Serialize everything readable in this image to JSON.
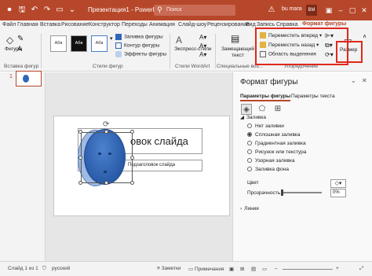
{
  "titlebar": {
    "title": "Презентация1 - PowerPoint",
    "search_placeholder": "Поиск",
    "user": "bu mara",
    "avatar": "BM",
    "bg_color": "#b7472a"
  },
  "tabs": [
    "Файл",
    "Главная",
    "Вставка",
    "Рисование",
    "Конструктор",
    "Переходы",
    "Анимация",
    "Слайд-шоу",
    "Рецензирование",
    "Вид",
    "Запись",
    "Справка",
    "Формат фигуры"
  ],
  "active_tab": "Формат фигуры",
  "ribbon": {
    "insert_shapes_label": "Фигуры",
    "insert_shapes_group": "Вставка фигур",
    "style_box_label": "Абв",
    "fill_label": "Заливка фигуры",
    "outline_label": "Контур фигуры",
    "effects_label": "Эффекты фигуры",
    "shape_styles_group": "Стили фигур",
    "express_styles_label": "Экспресс-стили",
    "wordart_group": "Стили WordArt",
    "alt_text_label": "Замещающий текст",
    "accessibility_group": "Специальные воз...",
    "bring_forward": "Переместить вперед",
    "send_backward": "Переместить назад",
    "selection_pane": "Область выделения",
    "arrange_group": "Упорядочение",
    "size_label": "Размер"
  },
  "thumbnails": {
    "slide_number": "1"
  },
  "slide": {
    "title_placeholder": "овок слайда",
    "subtitle_placeholder": "Подзаголовок слайда"
  },
  "pane": {
    "title": "Формат фигуры",
    "tab_shape": "Параметры фигуры",
    "tab_text": "Параметры текста",
    "fill_section": "Заливка",
    "fill_options": [
      "Нет заливки",
      "Сплошная заливка",
      "Градиентная заливка",
      "Рисунок или текстура",
      "Узорная заливка",
      "Заливка фона"
    ],
    "selected_fill_index": 1,
    "color_label": "Цвет",
    "transparency_label": "Прозрачность",
    "transparency_value": "0%",
    "line_section": "Линия"
  },
  "statusbar": {
    "slide_info": "Слайд 1 из 1",
    "language": "русский",
    "notes": "Заметки",
    "comments": "Примечания"
  },
  "colors": {
    "accent": "#b7472a",
    "shape_fill": "#2f66b8",
    "highlight": "#e0281c"
  }
}
